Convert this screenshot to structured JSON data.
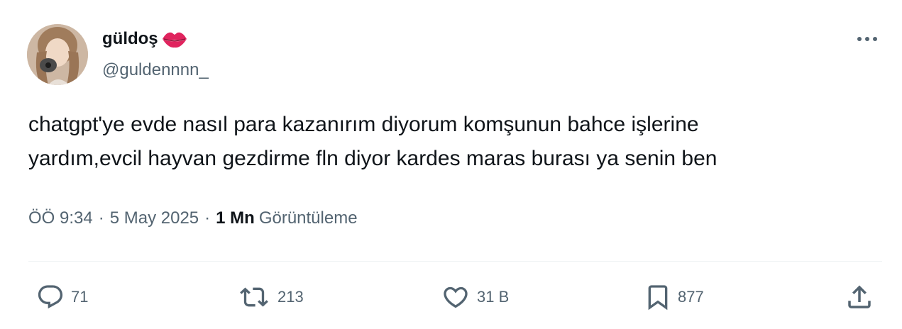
{
  "author": {
    "display_name": "güldoş",
    "emoji_icon": "kiss-mark-icon",
    "handle": "@guldennnn_"
  },
  "tweet": {
    "text": "chatgpt'ye evde nasıl para kazanırım diyorum komşunun bahce işlerine\nyardım,evcil hayvan gezdirme fln diyor kardes maras burası ya senin ben"
  },
  "meta": {
    "time": "ÖÖ 9:34",
    "date": "5 May 2025",
    "separator": "·",
    "views_count": "1 Mn",
    "views_label": "Görüntüleme"
  },
  "actions": {
    "replies": "71",
    "reposts": "213",
    "likes": "31 B",
    "bookmarks": "877"
  },
  "colors": {
    "text_primary": "#0f1419",
    "text_secondary": "#536471",
    "divider": "#eff3f4",
    "emoji_red": "#e0245e"
  }
}
